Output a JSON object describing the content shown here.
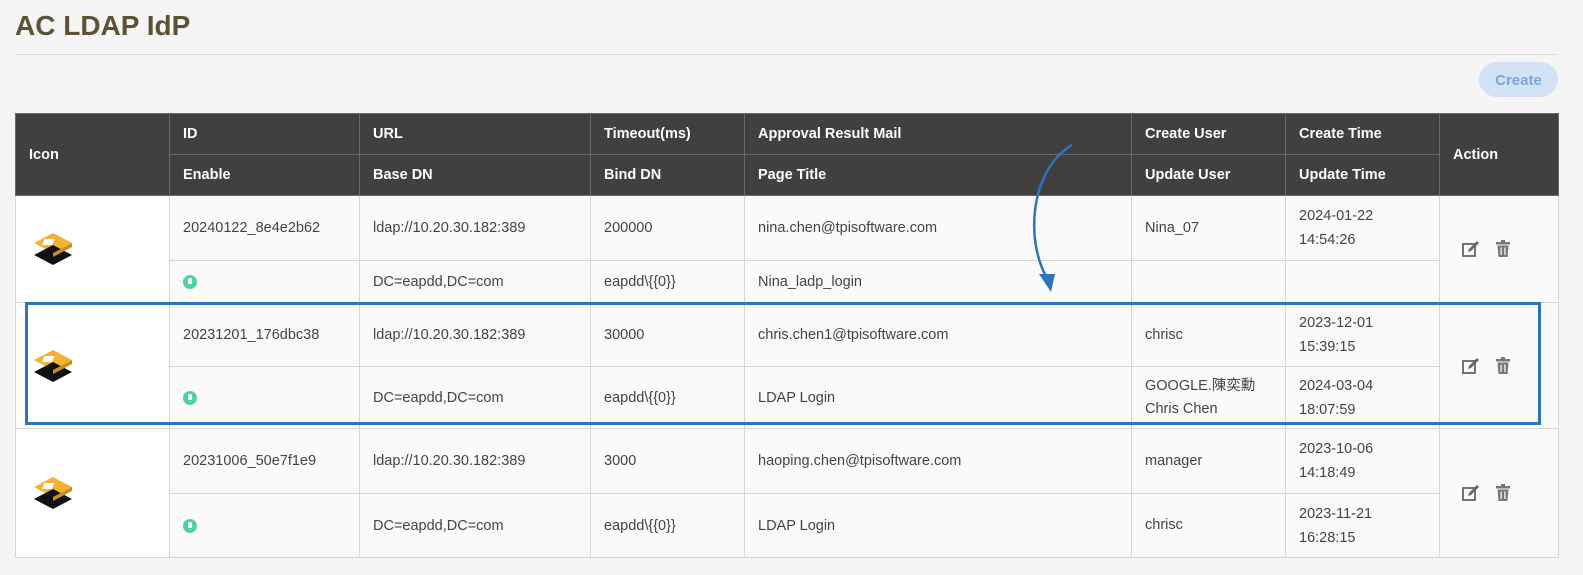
{
  "page": {
    "title": "AC LDAP IdP"
  },
  "toolbar": {
    "create_label": "Create"
  },
  "columns": {
    "icon": "Icon",
    "id": "ID",
    "enable": "Enable",
    "url": "URL",
    "base_dn": "Base DN",
    "timeout": "Timeout(ms)",
    "bind_dn": "Bind DN",
    "approval_mail": "Approval Result Mail",
    "page_title": "Page Title",
    "create_user": "Create User",
    "update_user": "Update User",
    "create_time": "Create Time",
    "update_time": "Update Time",
    "action": "Action"
  },
  "rows": [
    {
      "id": "20240122_8e4e2b62",
      "url": "ldap://10.20.30.182:389",
      "timeout": "200000",
      "approval_mail": "nina.chen@tpisoftware.com",
      "create_user": "Nina_07",
      "create_time_date": "2024-01-22",
      "create_time_clock": "14:54:26",
      "base_dn": "DC=eapdd,DC=com",
      "bind_dn": "eapdd\\{{0}}",
      "page_title": "Nina_ladp_login",
      "update_user_1": "",
      "update_user_2": "",
      "update_time_date": "",
      "update_time_clock": ""
    },
    {
      "id": "20231201_176dbc38",
      "url": "ldap://10.20.30.182:389",
      "timeout": "30000",
      "approval_mail": "chris.chen1@tpisoftware.com",
      "create_user": "chrisc",
      "create_time_date": "2023-12-01",
      "create_time_clock": "15:39:15",
      "base_dn": "DC=eapdd,DC=com",
      "bind_dn": "eapdd\\{{0}}",
      "page_title": "LDAP Login",
      "update_user_1": "GOOGLE.陳奕勳",
      "update_user_2": "Chris Chen",
      "update_time_date": "2024-03-04",
      "update_time_clock": "18:07:59"
    },
    {
      "id": "20231006_50e7f1e9",
      "url": "ldap://10.20.30.182:389",
      "timeout": "3000",
      "approval_mail": "haoping.chen@tpisoftware.com",
      "create_user": "manager",
      "create_time_date": "2023-10-06",
      "create_time_clock": "14:18:49",
      "base_dn": "DC=eapdd,DC=com",
      "bind_dn": "eapdd\\{{0}}",
      "page_title": "LDAP Login",
      "update_user_1": "chrisc",
      "update_user_2": "",
      "update_time_date": "2023-11-21",
      "update_time_clock": "16:28:15"
    }
  ],
  "colors": {
    "header_bg": "#404040",
    "accent_blue": "#2e74bd",
    "enable_green": "#4fd3a4",
    "logo_orange": "#f2b233"
  },
  "icons": {
    "logo": "stacked-layers-logo-icon",
    "enable": "enabled-status-icon",
    "edit": "edit-icon",
    "delete": "trash-icon"
  }
}
